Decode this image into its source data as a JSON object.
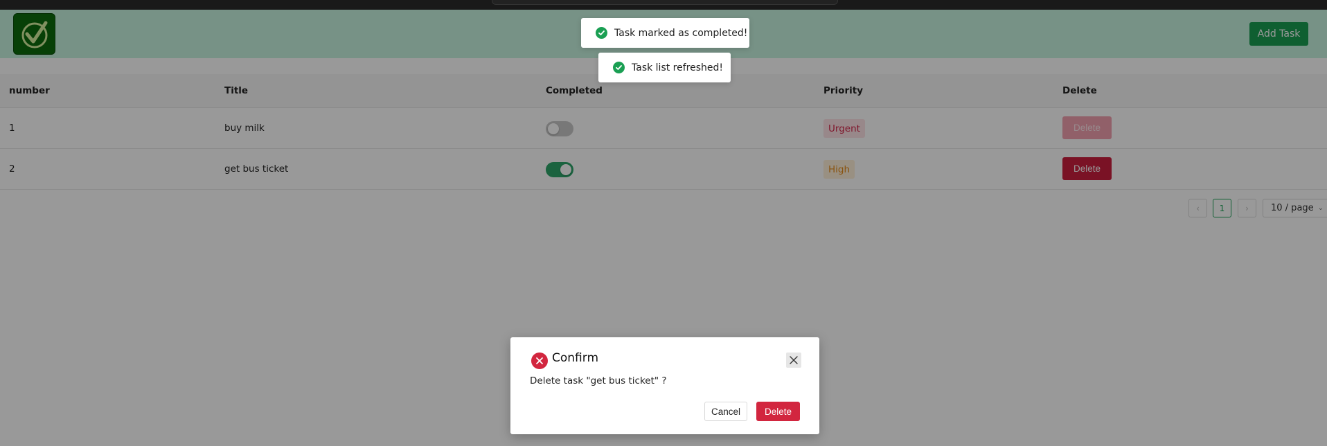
{
  "header": {
    "add_task_label": "Add Task"
  },
  "table": {
    "columns": [
      "number",
      "Title",
      "Completed",
      "Priority",
      "Delete"
    ],
    "rows": [
      {
        "number": "1",
        "title": "buy milk",
        "completed": false,
        "priority": "Urgent",
        "delete_label": "Delete"
      },
      {
        "number": "2",
        "title": "get bus ticket",
        "completed": true,
        "priority": "High",
        "delete_label": "Delete"
      }
    ]
  },
  "pagination": {
    "prev_icon": "‹",
    "current_page": "1",
    "next_icon": "›",
    "page_size": "10 / page"
  },
  "toasts": [
    {
      "text": "Task marked as completed!",
      "icon": "check-circle-icon"
    },
    {
      "text": "Task list refreshed!",
      "icon": "check-circle-icon"
    }
  ],
  "modal": {
    "title": "Confirm",
    "message": "Delete task \"get bus ticket\" ?",
    "cancel_label": "Cancel",
    "confirm_label": "Delete"
  },
  "colors": {
    "header_bg": "#c6f3df",
    "primary_green": "#1a9f53",
    "danger_red": "#d2263f",
    "urgent_tag": "#d4264a",
    "high_tag": "#e48a1a"
  }
}
